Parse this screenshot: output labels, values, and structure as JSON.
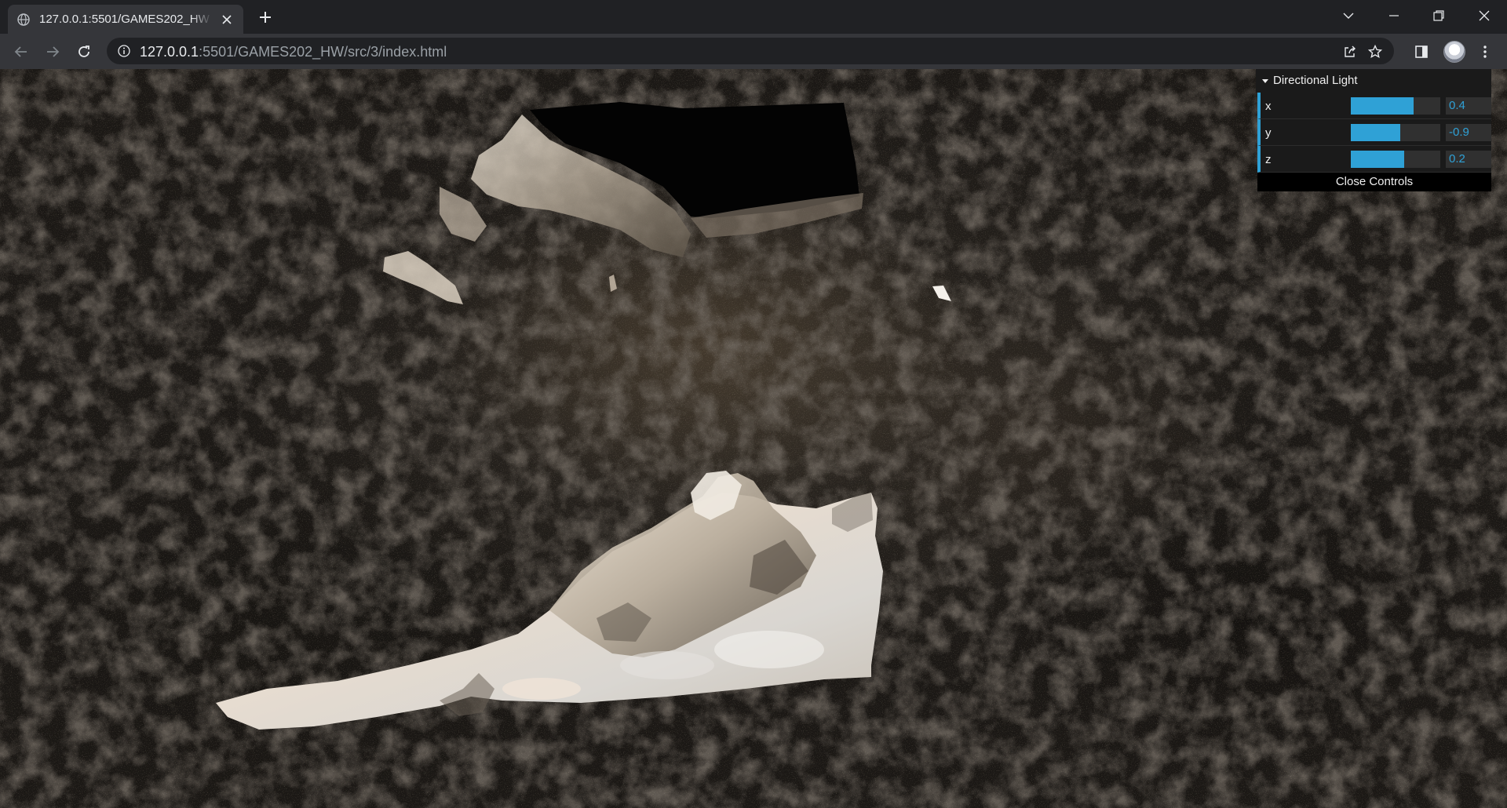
{
  "browser": {
    "tab_title": "127.0.0.1:5501/GAMES202_HW",
    "url_host": "127.0.0.1",
    "url_rest": ":5501/GAMES202_HW/src/3/index.html"
  },
  "gui": {
    "folder_title": "Directional Light",
    "controls": [
      {
        "name": "x",
        "value": "0.4",
        "fill": 0.7
      },
      {
        "name": "y",
        "value": "-0.9",
        "fill": 0.55
      },
      {
        "name": "z",
        "value": "0.2",
        "fill": 0.6
      }
    ],
    "close_label": "Close Controls",
    "accent": "#2fa1d6"
  },
  "icons": {
    "favicon": "globe-icon",
    "back": "arrow-left-icon",
    "forward": "arrow-right-icon",
    "reload": "reload-icon",
    "info": "info-icon",
    "share": "share-icon",
    "bookmark": "star-icon",
    "sidepanel": "side-panel-icon",
    "menu": "kebab-menu-icon"
  }
}
